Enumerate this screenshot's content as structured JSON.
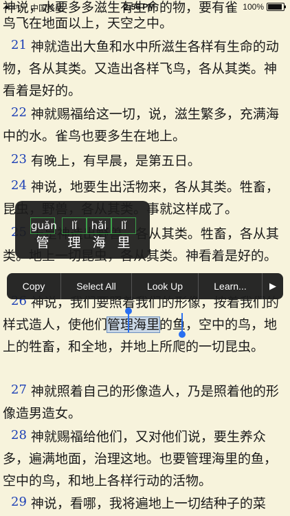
{
  "status_bar": {
    "signal": "●○○○○",
    "carrier": "中国移动",
    "time": "2:56 PM",
    "battery_percent": "100%",
    "battery_level": 1.0
  },
  "reader": {
    "top_partial_line": "神说，水要多多滋生有生命的物，要有雀",
    "verse20_tail": "鸟飞在地面以上，天空之中。",
    "verses": [
      {
        "num": "21",
        "text": "神就造出大鱼和水中所滋生各样有生命的动物，各从其类。又造出各样飞鸟，各从其类。神看着是好的。"
      },
      {
        "num": "22",
        "text": "神就赐福给这一切，说，滋生繁多，充满海中的水。雀鸟也要多生在地上。"
      },
      {
        "num": "23",
        "text": "有晚上，有早晨，是第五日。"
      },
      {
        "num": "24",
        "text": "神说，地要生出活物来，各从其类。牲畜，昆虫，野兽，各从其类。事就这样成了。"
      },
      {
        "num": "25",
        "text": "于是神造出野兽，各从其类。牲畜，各从其类。地上一切昆虫，各从其类。神看着是好的。"
      },
      {
        "num": "26",
        "text_before": "神说，我们要照着我们的形像，按着我们的样式造人，使他们",
        "text_selected": "管理海里",
        "text_after": "的鱼，空中的鸟，地上的牲畜，和全地，并地上所爬的一切昆虫。"
      },
      {
        "num": "27",
        "text": "神就照着自己的形像造人，乃是照着他的形像造男造女。"
      },
      {
        "num": "28",
        "text": "神就赐福给他们，又对他们说，要生养众多，遍满地面，治理这地。也要管理海里的鱼，空中的鸟，和地上各样行动的活物。"
      },
      {
        "num": "29",
        "text": "神说，看哪，我将遍地上一切结种子的菜"
      }
    ]
  },
  "pinyin_popup": {
    "chars": [
      {
        "pinyin": "guǎn",
        "hanzi": "管"
      },
      {
        "pinyin": "lǐ",
        "hanzi": "理"
      },
      {
        "pinyin": "hǎi",
        "hanzi": "海"
      },
      {
        "pinyin": "lǐ",
        "hanzi": "里"
      }
    ]
  },
  "edit_menu": {
    "copy": "Copy",
    "select_all": "Select All",
    "look_up": "Look Up",
    "learn": "Learn...",
    "more": "▶"
  }
}
